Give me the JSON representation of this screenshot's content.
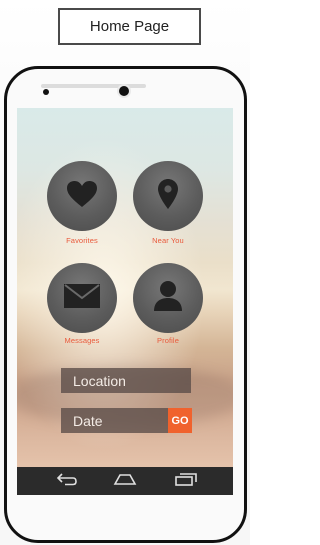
{
  "header": {
    "page_label": "Home Page"
  },
  "apps": [
    {
      "label": "Favorites",
      "icon": "heart-icon"
    },
    {
      "label": "Near You",
      "icon": "map-pin-icon"
    },
    {
      "label": "Messages",
      "icon": "envelope-icon"
    },
    {
      "label": "Profile",
      "icon": "user-icon"
    }
  ],
  "form": {
    "location_label": "Location",
    "date_label": "Date",
    "go_label": "GO"
  },
  "navbar": {
    "buttons": [
      "back-icon",
      "home-icon",
      "recent-apps-icon"
    ]
  },
  "colors": {
    "accent": "#f0622d",
    "label_text": "#e95a3c",
    "icon_circle": "#5c5c5c",
    "nav_bar": "#2b2b2b"
  }
}
